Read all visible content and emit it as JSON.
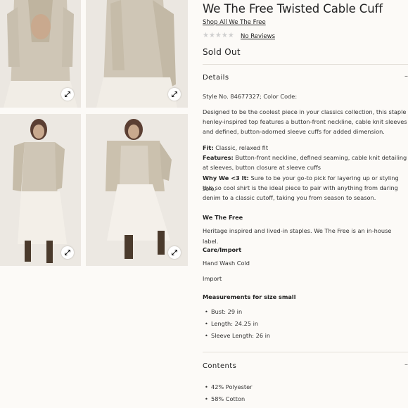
{
  "product": {
    "title": "We The Free Twisted Cable Cuff",
    "brand_link": "Shop All We The Free",
    "stars": "★★★★★",
    "reviews_label": "No Reviews",
    "status": "Sold Out"
  },
  "details": {
    "heading": "Details",
    "toggle": "–",
    "style_line": "Style No. 84677327; Color Code:",
    "description": [
      "Designed to be the coolest piece in your classics collection, this staple",
      "henley-inspired top features a button-front neckline, cable knit sleeves",
      "and defined, button-adorned sleeve cuffs for added dimension."
    ],
    "fit_label": "Fit:",
    "fit_value": " Classic, relaxed fit",
    "features_label": "Features:",
    "features_line1": " Button-front neckline, defined seaming, cable knit detailing",
    "features_line2": "at sleeves, button closure at sleeve cuffs",
    "why_label": "Why We <3 It:",
    "why_line1": " Sure to be your go-to pick for layering up or styling solo,",
    "why_line2": "this so cool shirt is the ideal piece to pair with anything from daring",
    "why_line3": "denim to a classic cutoff, taking you from season to season.",
    "brand_heading": "We The Free",
    "brand_text": "Heritage inspired and lived-in staples. We The Free is an in-house label.",
    "care_heading": "Care/Import",
    "care_value": "Hand Wash Cold",
    "import_value": "Import",
    "measure_heading": "Measurements for size small",
    "measurements": [
      "Bust: 29 in",
      "Length: 24.25 in",
      "Sleeve Length: 26 in"
    ]
  },
  "contents": {
    "heading": "Contents",
    "toggle": "–",
    "items": [
      "42% Polyester",
      "58% Cotton"
    ]
  },
  "icons": {
    "zoom": "expand-arrows-icon",
    "star": "star-icon"
  },
  "colors": {
    "background": "#fcfaf7",
    "divider": "#e3dfd9",
    "star_empty": "#cfcfcf"
  }
}
